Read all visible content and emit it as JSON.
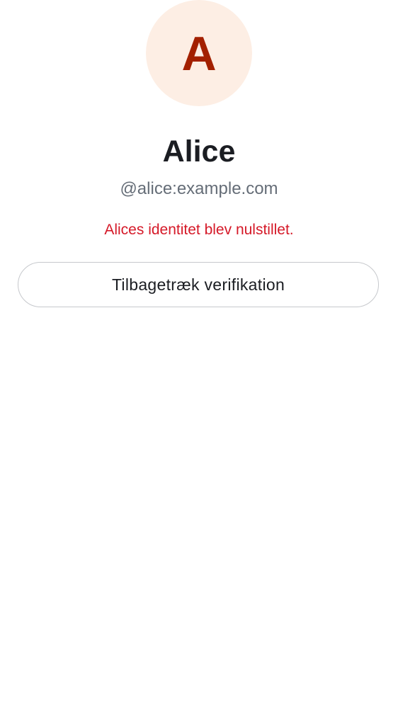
{
  "profile": {
    "avatar_initial": "A",
    "display_name": "Alice",
    "user_id": "@alice:example.com"
  },
  "warning": {
    "text": "Alices identitet blev nulstillet."
  },
  "actions": {
    "withdraw_verification_label": "Tilbagetræk verifikation"
  },
  "colors": {
    "avatar_bg": "#fdeee4",
    "avatar_letter": "#a32000",
    "name": "#1b1d22",
    "user_id": "#656d77",
    "warning": "#d51928",
    "button_border": "#c6c8cc"
  }
}
